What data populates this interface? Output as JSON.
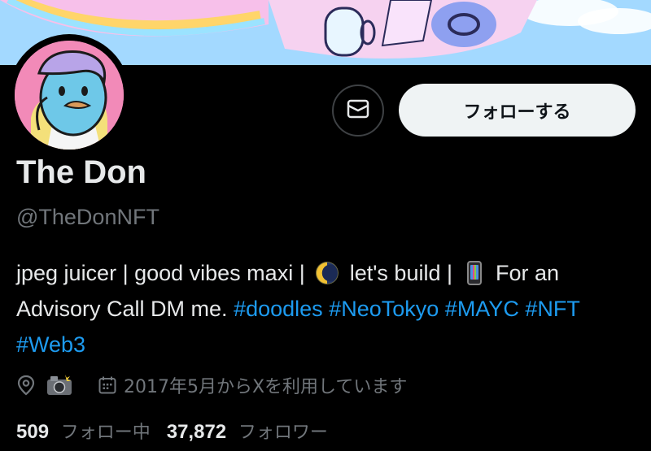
{
  "profile": {
    "name": "The Don",
    "handle": "@TheDonNFT",
    "follow_label": "フォローする",
    "message_icon": "envelope-icon",
    "avatar_icon": "doodle-avatar"
  },
  "bio": {
    "part1": "jpeg juicer | good vibes maxi |",
    "emoji1": "moon-emoji",
    "part2": "let's build |",
    "emoji2": "phone-emoji",
    "part3": "For an Advisory Call DM me.",
    "tags": [
      "#doodles",
      "#NeoTokyo",
      "#MAYC",
      "#NFT",
      "#Web3"
    ]
  },
  "meta": {
    "location_icon": "location-pin-icon",
    "location_emoji": "camera-flash-emoji",
    "joined_icon": "calendar-icon",
    "joined": "2017年5月からXを利用しています"
  },
  "stats": {
    "following_count": "509",
    "following_label": "フォロー中",
    "followers_count": "37,872",
    "followers_label": "フォロワー"
  },
  "colors": {
    "background": "#000000",
    "text": "#e7e9ea",
    "muted": "#71767b",
    "link": "#1d9bf0",
    "button_bg": "#eff3f4"
  }
}
